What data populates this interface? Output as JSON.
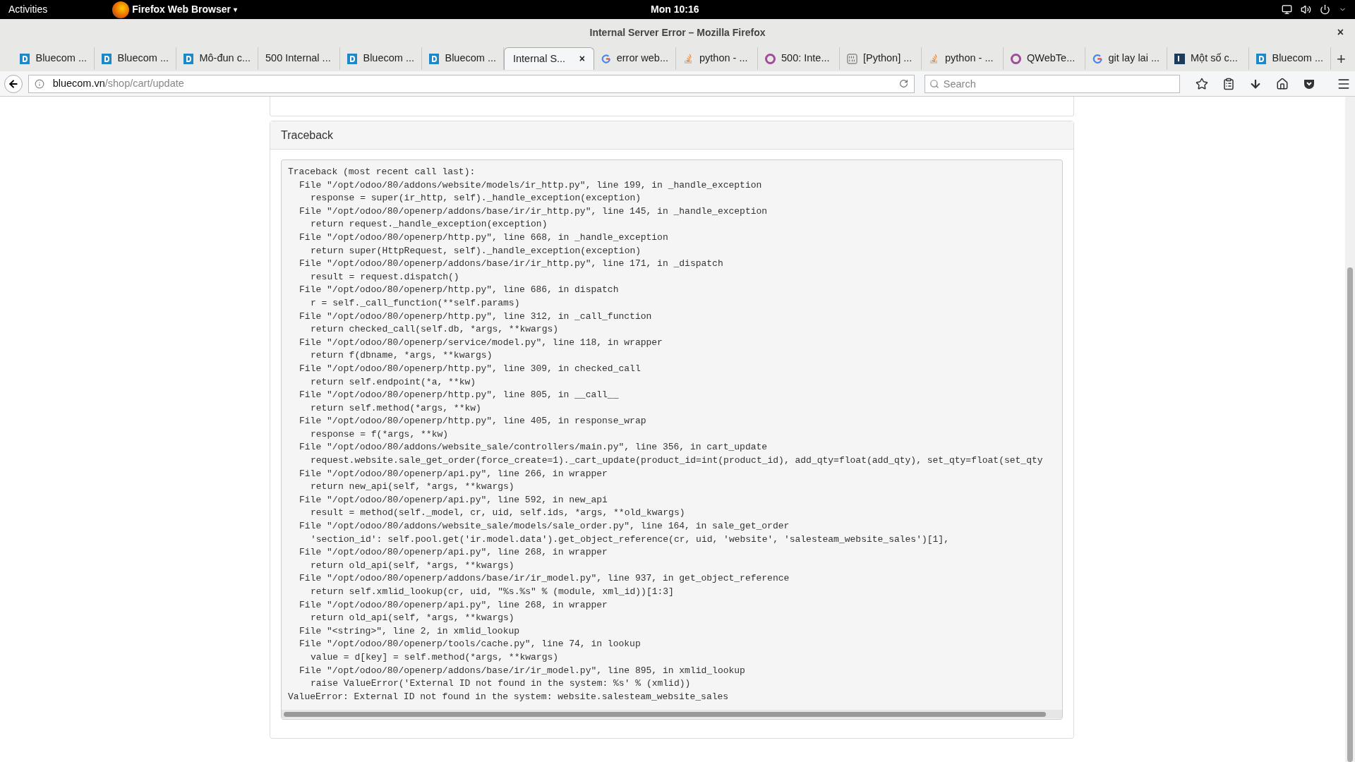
{
  "top_bar": {
    "activities": "Activities",
    "app_menu": "Firefox Web Browser",
    "app_menu_caret": "▾",
    "clock": "Mon 10:16"
  },
  "window": {
    "title": "Internal Server Error – Mozilla Firefox",
    "close": "×"
  },
  "tabs": [
    {
      "label": "Bluecom ...",
      "kind": "bluecom",
      "selected": false
    },
    {
      "label": "Bluecom ...",
      "kind": "bluecom",
      "selected": false
    },
    {
      "label": "Mô-đun c...",
      "kind": "bluecom",
      "selected": false
    },
    {
      "label": "500 Internal ...",
      "kind": "plain",
      "selected": false
    },
    {
      "label": "Bluecom ...",
      "kind": "bluecom",
      "selected": false
    },
    {
      "label": "Bluecom ...",
      "kind": "bluecom",
      "selected": false
    },
    {
      "label": "Internal S...",
      "kind": "plain",
      "selected": true
    },
    {
      "label": "error web...",
      "kind": "google",
      "selected": false
    },
    {
      "label": "python - ...",
      "kind": "stack",
      "selected": false
    },
    {
      "label": "500: Inte...",
      "kind": "ring",
      "selected": false
    },
    {
      "label": "[Python] ...",
      "kind": "binary",
      "selected": false
    },
    {
      "label": "python - ...",
      "kind": "stack",
      "selected": false
    },
    {
      "label": "QWebTe...",
      "kind": "ring",
      "selected": false
    },
    {
      "label": "git lay lai ...",
      "kind": "google",
      "selected": false
    },
    {
      "label": "Một số c...",
      "kind": "k",
      "selected": false
    },
    {
      "label": "Bluecom ...",
      "kind": "bluecom",
      "selected": false
    }
  ],
  "tab_close": "×",
  "new_tab": "+",
  "nav": {
    "url_host": "bluecom.vn",
    "url_path": "/shop/cart/update",
    "search_placeholder": "Search"
  },
  "panel": {
    "title": "Traceback",
    "lines": [
      {
        "kind": "head",
        "text": "Traceback (most recent call last):"
      },
      {
        "kind": "file",
        "text": "File \"/opt/odoo/80/addons/website/models/ir_http.py\", line 199, in _handle_exception"
      },
      {
        "kind": "code",
        "text": "response = super(ir_http, self)._handle_exception(exception)"
      },
      {
        "kind": "file",
        "text": "File \"/opt/odoo/80/openerp/addons/base/ir/ir_http.py\", line 145, in _handle_exception"
      },
      {
        "kind": "code",
        "text": "return request._handle_exception(exception)"
      },
      {
        "kind": "file",
        "text": "File \"/opt/odoo/80/openerp/http.py\", line 668, in _handle_exception"
      },
      {
        "kind": "code",
        "text": "return super(HttpRequest, self)._handle_exception(exception)"
      },
      {
        "kind": "file",
        "text": "File \"/opt/odoo/80/openerp/addons/base/ir/ir_http.py\", line 171, in _dispatch"
      },
      {
        "kind": "code",
        "text": "result = request.dispatch()"
      },
      {
        "kind": "file",
        "text": "File \"/opt/odoo/80/openerp/http.py\", line 686, in dispatch"
      },
      {
        "kind": "code",
        "text": "r = self._call_function(**self.params)"
      },
      {
        "kind": "file",
        "text": "File \"/opt/odoo/80/openerp/http.py\", line 312, in _call_function"
      },
      {
        "kind": "code",
        "text": "return checked_call(self.db, *args, **kwargs)"
      },
      {
        "kind": "file",
        "text": "File \"/opt/odoo/80/openerp/service/model.py\", line 118, in wrapper"
      },
      {
        "kind": "code",
        "text": "return f(dbname, *args, **kwargs)"
      },
      {
        "kind": "file",
        "text": "File \"/opt/odoo/80/openerp/http.py\", line 309, in checked_call"
      },
      {
        "kind": "code",
        "text": "return self.endpoint(*a, **kw)"
      },
      {
        "kind": "file",
        "text": "File \"/opt/odoo/80/openerp/http.py\", line 805, in __call__"
      },
      {
        "kind": "code",
        "text": "return self.method(*args, **kw)"
      },
      {
        "kind": "file",
        "text": "File \"/opt/odoo/80/openerp/http.py\", line 405, in response_wrap"
      },
      {
        "kind": "code",
        "text": "response = f(*args, **kw)"
      },
      {
        "kind": "file",
        "text": "File \"/opt/odoo/80/addons/website_sale/controllers/main.py\", line 356, in cart_update"
      },
      {
        "kind": "code",
        "text": "request.website.sale_get_order(force_create=1)._cart_update(product_id=int(product_id), add_qty=float(add_qty), set_qty=float(set_qty"
      },
      {
        "kind": "file",
        "text": "File \"/opt/odoo/80/openerp/api.py\", line 266, in wrapper"
      },
      {
        "kind": "code",
        "text": "return new_api(self, *args, **kwargs)"
      },
      {
        "kind": "file",
        "text": "File \"/opt/odoo/80/openerp/api.py\", line 592, in new_api"
      },
      {
        "kind": "code",
        "text": "result = method(self._model, cr, uid, self.ids, *args, **old_kwargs)"
      },
      {
        "kind": "file",
        "text": "File \"/opt/odoo/80/addons/website_sale/models/sale_order.py\", line 164, in sale_get_order"
      },
      {
        "kind": "code",
        "text": "'section_id': self.pool.get('ir.model.data').get_object_reference(cr, uid, 'website', 'salesteam_website_sales')[1],"
      },
      {
        "kind": "file",
        "text": "File \"/opt/odoo/80/openerp/api.py\", line 268, in wrapper"
      },
      {
        "kind": "code",
        "text": "return old_api(self, *args, **kwargs)"
      },
      {
        "kind": "file",
        "text": "File \"/opt/odoo/80/openerp/addons/base/ir/ir_model.py\", line 937, in get_object_reference"
      },
      {
        "kind": "code",
        "text": "return self.xmlid_lookup(cr, uid, \"%s.%s\" % (module, xml_id))[1:3]"
      },
      {
        "kind": "file",
        "text": "File \"/opt/odoo/80/openerp/api.py\", line 268, in wrapper"
      },
      {
        "kind": "code",
        "text": "return old_api(self, *args, **kwargs)"
      },
      {
        "kind": "file",
        "text": "File \"<string>\", line 2, in xmlid_lookup"
      },
      {
        "kind": "file",
        "text": "File \"/opt/odoo/80/openerp/tools/cache.py\", line 74, in lookup"
      },
      {
        "kind": "code",
        "text": "value = d[key] = self.method(*args, **kwargs)"
      },
      {
        "kind": "file",
        "text": "File \"/opt/odoo/80/openerp/addons/base/ir/ir_model.py\", line 895, in xmlid_lookup"
      },
      {
        "kind": "code",
        "text": "raise ValueError('External ID not found in the system: %s' % (xmlid))"
      },
      {
        "kind": "head",
        "text": "ValueError: External ID not found in the system: website.salesteam_website_sales"
      }
    ]
  }
}
